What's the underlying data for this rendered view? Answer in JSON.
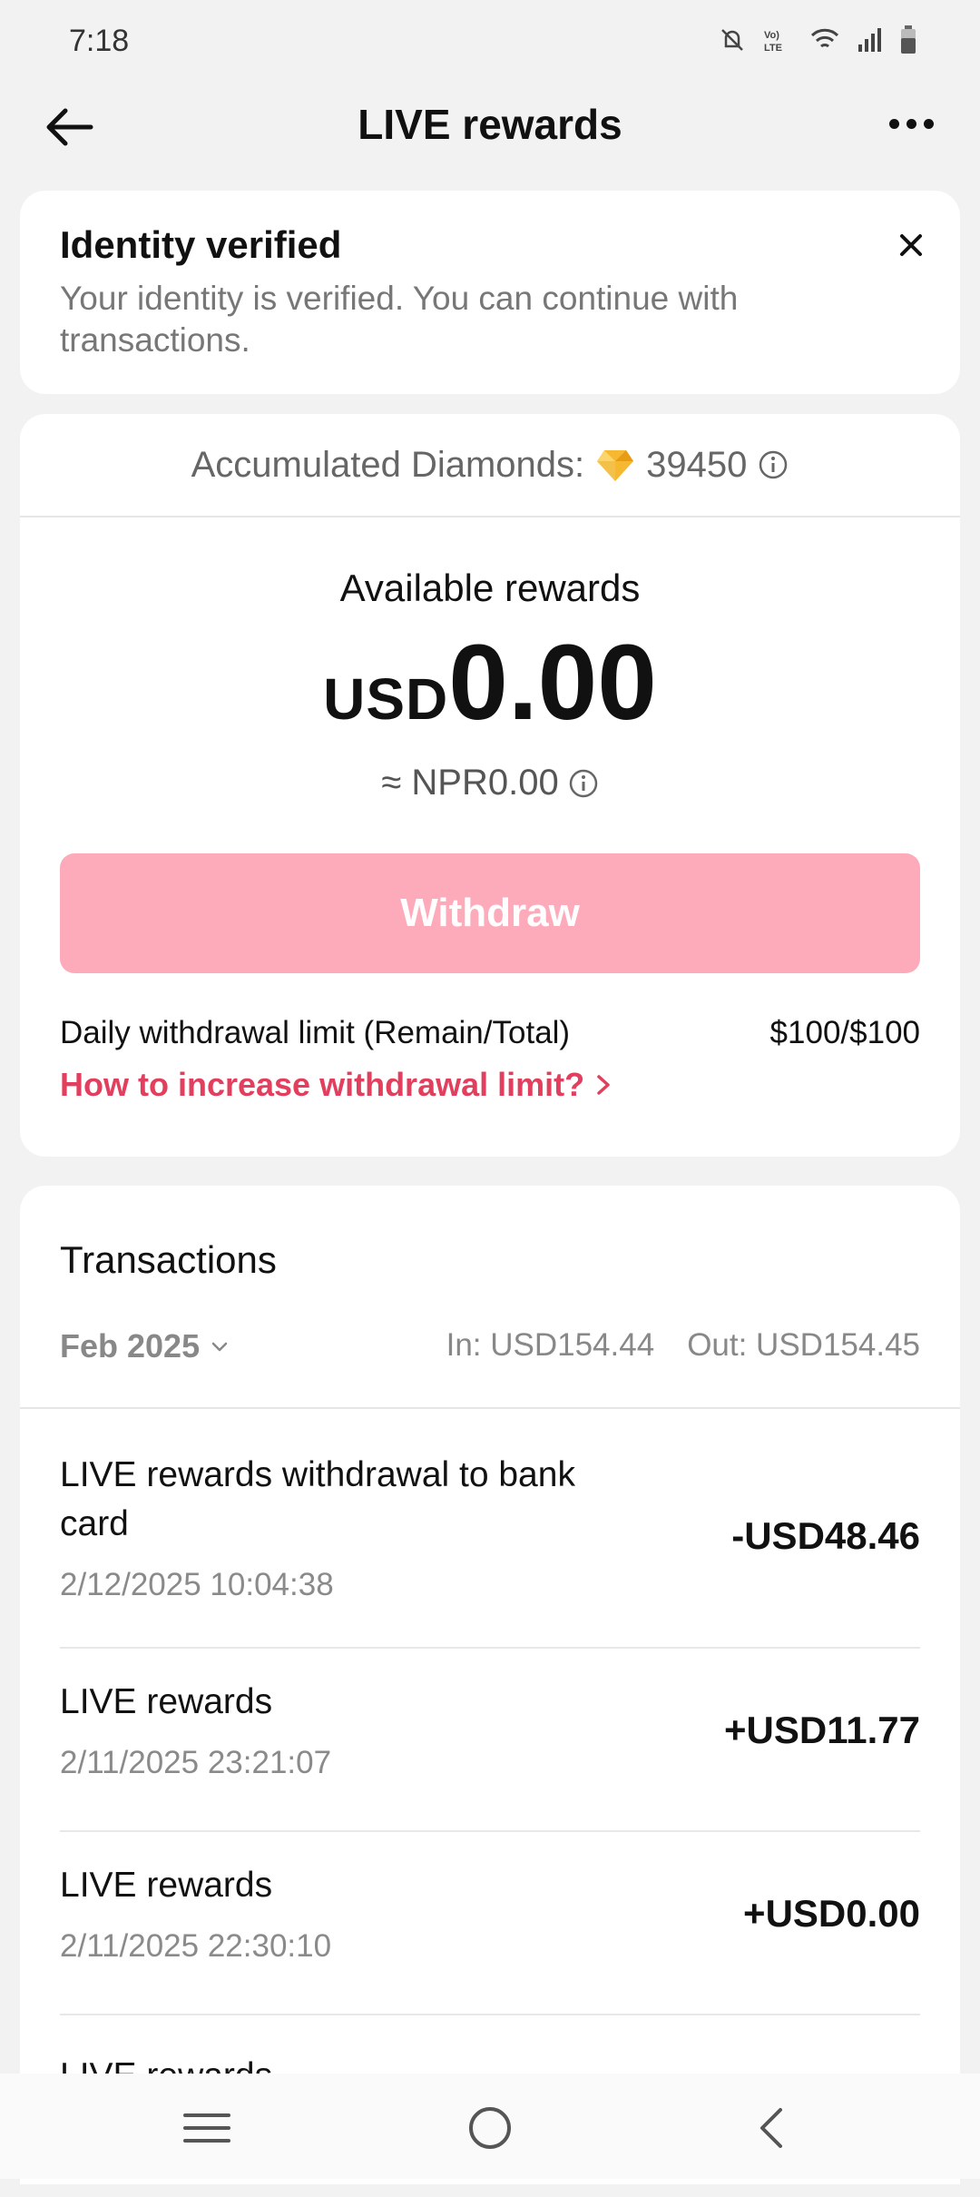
{
  "status_bar": {
    "time": "7:18",
    "icons": [
      "mute-icon",
      "volte-icon",
      "wifi-icon",
      "signal-icon",
      "battery-icon"
    ]
  },
  "header": {
    "title": "LIVE rewards"
  },
  "identity": {
    "title": "Identity verified",
    "message": "Your identity is verified. You can continue with transactions."
  },
  "rewards": {
    "accumulated_label": "Accumulated Diamonds:",
    "accumulated_value": "39450",
    "available_label": "Available rewards",
    "currency": "USD",
    "amount": "0.00",
    "approx": "≈ NPR0.00",
    "withdraw_label": "Withdraw",
    "limit_label": "Daily withdrawal limit (Remain/Total)",
    "limit_value": "$100/$100",
    "limit_link": "How to increase withdrawal limit?"
  },
  "transactions": {
    "title": "Transactions",
    "month": "Feb 2025",
    "in_total": "In: USD154.44",
    "out_total": "Out: USD154.45",
    "items": [
      {
        "name": "LIVE rewards withdrawal to bank card",
        "date": "2/12/2025 10:04:38",
        "amount": "-USD48.46"
      },
      {
        "name": "LIVE rewards",
        "date": "2/11/2025 23:21:07",
        "amount": "+USD11.77"
      },
      {
        "name": "LIVE rewards",
        "date": "2/11/2025 22:30:10",
        "amount": "+USD0.00"
      },
      {
        "name": "LIVE rewards",
        "date": "",
        "amount": ""
      }
    ]
  },
  "colors": {
    "accent": "#e23e5e",
    "button_disabled": "#fdabba",
    "background": "#f2f2f2"
  }
}
